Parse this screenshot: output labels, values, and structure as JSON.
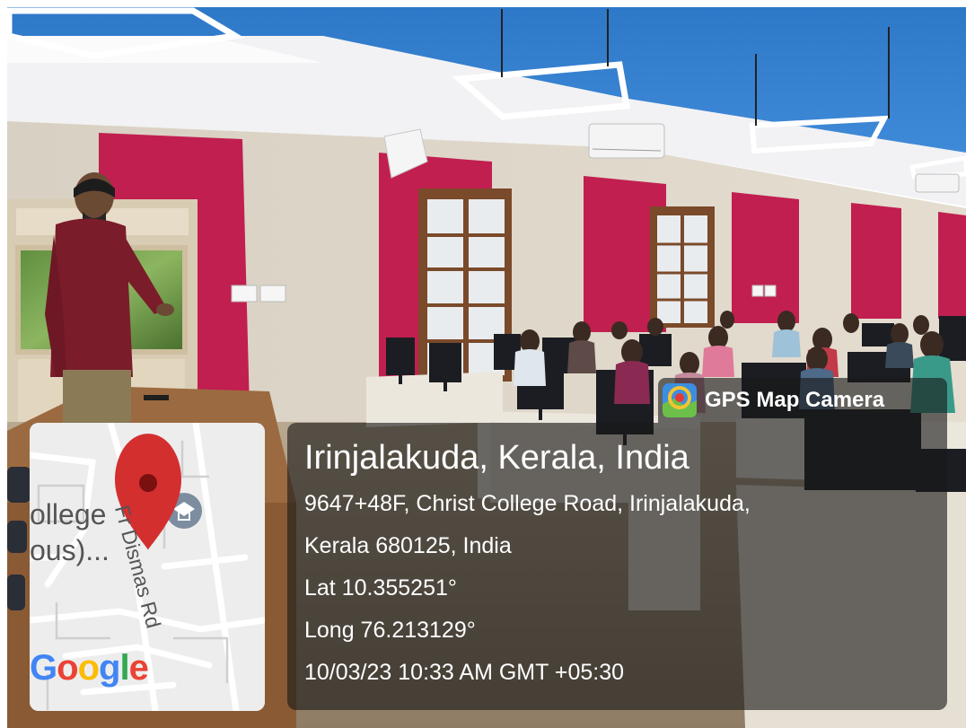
{
  "app": {
    "name": "GPS Map Camera",
    "icon": "gps-map-camera-icon",
    "icon_colors": {
      "bg": "#3c8fe0",
      "ring": "#f4c430",
      "pin": "#e53935"
    }
  },
  "location": {
    "title": "Irinjalakuda, Kerala, India",
    "address_line1": "9647+48F, Christ College Road, Irinjalakuda,",
    "address_line2": "Kerala 680125, India",
    "latitude": "Lat 10.355251°",
    "longitude": "Long 76.213129°",
    "datetime": "10/03/23 10:33 AM GMT +05:30"
  },
  "map": {
    "road_label": "Fr Dismas Rd",
    "poi_label_line1": "ollege",
    "poi_label_line2": "ous)...",
    "provider_logo": "Google",
    "marker_icon": "map-pin-icon",
    "poi_icon": "school-icon",
    "marker_color": "#d32f2f"
  }
}
